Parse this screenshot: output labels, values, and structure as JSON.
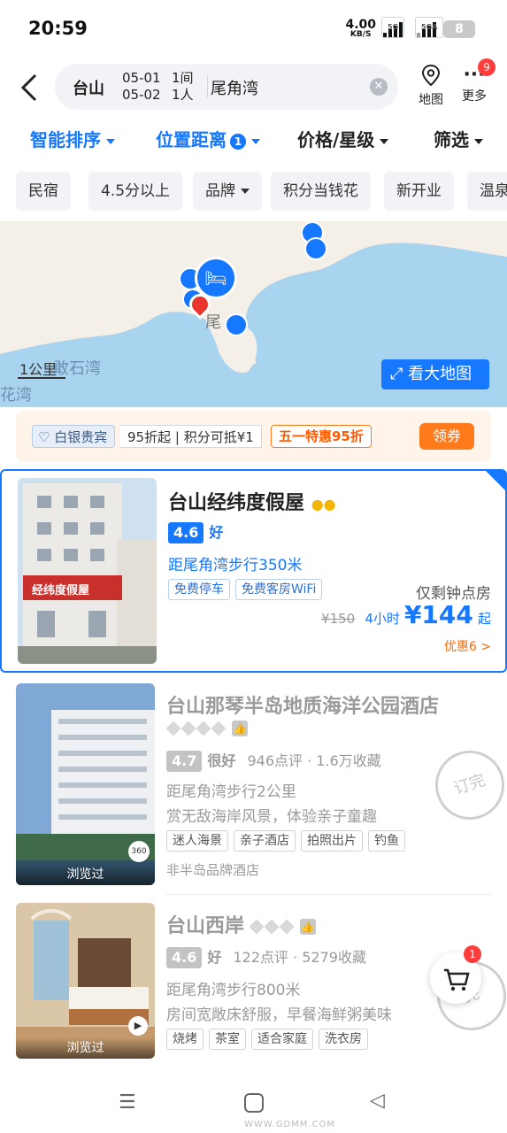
{
  "status_bar": {
    "time": "20:59",
    "net_speed": "4.00",
    "net_unit": "KB/S",
    "sim1": "5G",
    "sim2": "5GA",
    "battery": "8"
  },
  "header": {
    "city": "台山",
    "checkin": "05-01",
    "checkout": "05-02",
    "rooms": "1间",
    "guests": "1人",
    "keyword": "尾角湾",
    "map_label": "地图",
    "more_label": "更多",
    "more_badge": "9"
  },
  "sort": {
    "smart": "智能排序",
    "distance": "位置距离",
    "distance_badge": "1",
    "price": "价格/星级",
    "filter": "筛选"
  },
  "chips": [
    "民宿",
    "4.5分以上",
    "品牌",
    "积分当钱花",
    "新开业",
    "温泉"
  ],
  "map": {
    "scale": "1公里",
    "place1": "敢石湾",
    "place2": "花湾",
    "place3": "尾",
    "big_map": "看大地图"
  },
  "member": {
    "level": "白银贵宾",
    "discount": "95折起",
    "points": "积分可抵¥1",
    "promo": "五一特惠95折",
    "coupon": "领券"
  },
  "hotels": [
    {
      "name": "台山经纬度假屋",
      "score": "4.6",
      "rating_word": "好",
      "distance": "距尾角湾步行350米",
      "tags": [
        "免费停车",
        "免费客房WiFi"
      ],
      "room_note": "仅剩钟点房",
      "orig_price": "¥150",
      "hours": "4小时",
      "price": "¥144",
      "price_suffix": "起",
      "discount": "优惠6 >",
      "sign_text": "经纬度假屋"
    },
    {
      "name": "台山那琴半岛地质海洋公园酒店",
      "score": "4.7",
      "rating_word": "很好",
      "reviews": "946点评 · 1.6万收藏",
      "distance": "距尾角湾步行2公里",
      "highlight": "赏无敌海岸风景，体验亲子童趣",
      "tags": [
        "迷人海景",
        "亲子酒店",
        "拍照出片",
        "钓鱼"
      ],
      "brand": "非半岛品牌酒店",
      "viewed": "浏览过",
      "stamp": "订完",
      "photo_badge": "360"
    },
    {
      "name": "台山西岸",
      "score": "4.6",
      "rating_word": "好",
      "reviews": "122点评 · 5279收藏",
      "distance": "距尾角湾步行800米",
      "highlight": "房间宽敞床舒服，早餐海鲜粥美味",
      "tags": [
        "烧烤",
        "茶室",
        "适合家庭",
        "洗衣房"
      ],
      "viewed": "浏览过",
      "stamp": "完"
    }
  ],
  "cart_badge": "1",
  "watermark": "WWW.GDMM.COM"
}
